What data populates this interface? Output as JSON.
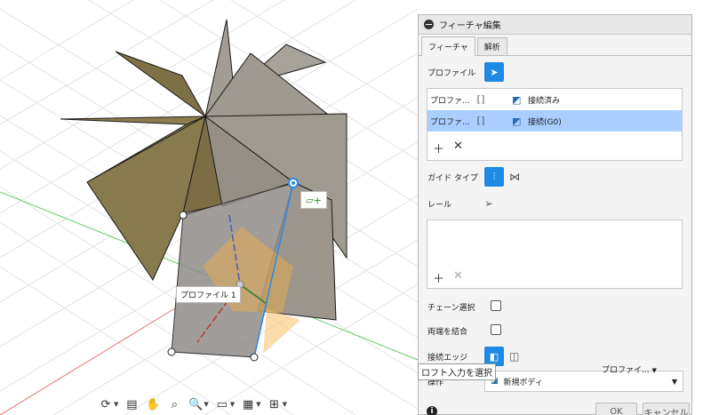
{
  "canvas": {
    "profile_label": "プロファイル 1"
  },
  "toolbar": {
    "items": [
      "orbit-icon",
      "look-at-icon",
      "pan-icon",
      "zoom-window-icon",
      "zoom-icon",
      "display-icon",
      "grid-icon",
      "viewports-icon"
    ]
  },
  "panel": {
    "title": "フィーチャ編集",
    "tabs": [
      "フィーチャ",
      "解析"
    ],
    "profile_label": "プロファイル",
    "profiles": [
      {
        "name": "プロファ...",
        "condition": "接続済み"
      },
      {
        "name": "プロファ...",
        "condition": "接続(G0)"
      }
    ],
    "guide_type_label": "ガイド タイプ",
    "rail_label": "レール",
    "chain_select_label": "チェーン選択",
    "merge_ends_label": "両端を結合",
    "tangent_edges_label": "接続エッジ",
    "operation_label": "操作",
    "operation_value": "新規ボディ",
    "ok_label": "OK",
    "cancel_label": "キャンセル"
  },
  "tooltip": {
    "text": "ロフト入力を選択",
    "mini_dropdown": "プロファイ..."
  },
  "colors": {
    "accent": "#1f8ae3",
    "selected_row": "#a9ceff",
    "surface_khaki": "#8c7d4e",
    "surface_gray": "#9c968c",
    "highlight_orange": "#f5b041"
  }
}
